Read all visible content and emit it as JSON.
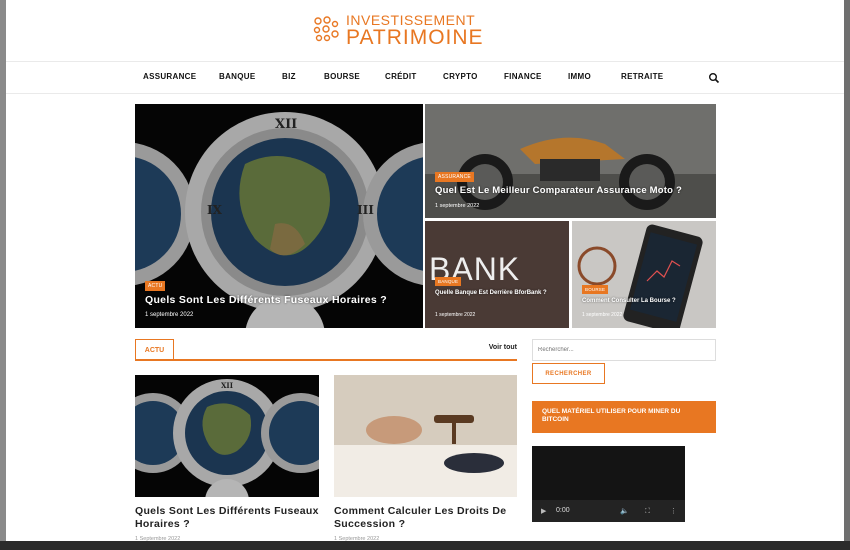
{
  "brand": {
    "line1": "INVESTISSEMENT",
    "line2": "PATRIMOINE",
    "accent": "#e87722"
  },
  "nav": {
    "items": [
      "ASSURANCE",
      "BANQUE",
      "BIZ",
      "BOURSE",
      "CRÉDIT",
      "CRYPTO",
      "FINANCE",
      "IMMO",
      "RETRAITE"
    ],
    "search_icon": "search-icon"
  },
  "featured": {
    "main": {
      "tag": "ACTU",
      "title": "Quels Sont Les Différents Fuseaux Horaires ?",
      "date": "1 septembre 2022"
    },
    "top_right": {
      "tag": "ASSURANCE",
      "title": "Quel Est Le Meilleur Comparateur Assurance Moto ?",
      "date": "1 septembre 2022"
    },
    "bottom_mid": {
      "tag": "BANQUE",
      "title": "Quelle Banque Est Derrière BforBank ?",
      "date": "1 septembre 2022",
      "image_text": "BANK"
    },
    "bottom_right": {
      "tag": "BOURSE",
      "title": "Comment Consulter La Bourse ?",
      "date": "1 septembre 2022"
    }
  },
  "section": {
    "label": "ACTU",
    "view_all": "Voir tout",
    "cards": [
      {
        "title_line1": "Quels Sont Les Différents Fuseaux",
        "title_line2": "Horaires ?",
        "date": "1 Septembre 2022"
      },
      {
        "title_line1": "Comment Calculer Les Droits De",
        "title_line2": "Succession ?",
        "date": "1 Septembre 2022"
      }
    ]
  },
  "sidebar": {
    "search_placeholder": "Rechercher...",
    "search_button": "RECHERCHER",
    "widget_title": "QUEL MATÉRIEL UTILISER POUR MINER DU BITCOIN",
    "video": {
      "time": "0:00"
    }
  }
}
